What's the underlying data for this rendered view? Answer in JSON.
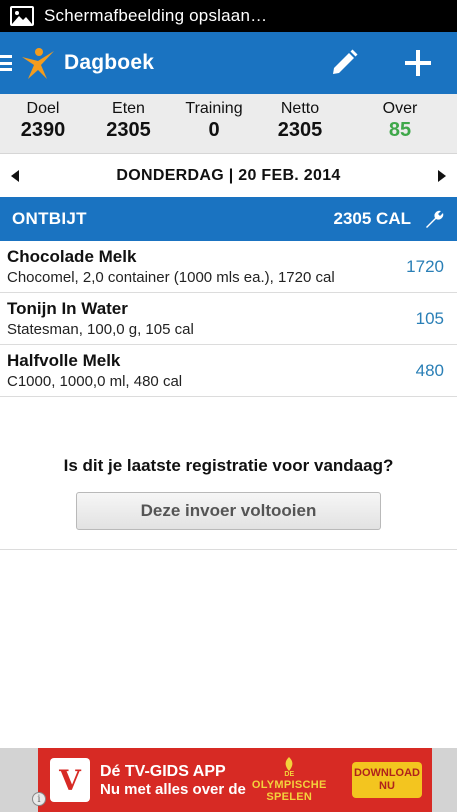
{
  "statusbar": {
    "text": "Schermafbeelding opslaan…",
    "icon": "image-icon"
  },
  "actionbar": {
    "title": "Dagboek",
    "color": "#1a73c1",
    "edit_icon": "pencil-icon",
    "add_icon": "plus-icon"
  },
  "summary": {
    "columns": [
      {
        "label": "Doel",
        "value": "2390"
      },
      {
        "label": "Eten",
        "value": "2305"
      },
      {
        "label": "Training",
        "value": "0"
      },
      {
        "label": "Netto",
        "value": "2305"
      },
      {
        "label": "Over",
        "value": "85"
      }
    ],
    "over_color": "#3fa84a"
  },
  "date": {
    "label": "DONDERDAG | 20 FEB. 2014"
  },
  "meal": {
    "name": "ONTBIJT",
    "calories": "2305 CAL"
  },
  "foods": [
    {
      "name": "Chocolade Melk",
      "description": "Chocomel, 2,0 container (1000 mls ea.), 1720 cal",
      "calories": "1720"
    },
    {
      "name": "Tonijn In Water",
      "description": "Statesman, 100,0 g, 105 cal",
      "calories": "105"
    },
    {
      "name": "Halfvolle Melk",
      "description": "C1000, 1000,0 ml, 480 cal",
      "calories": "480"
    }
  ],
  "complete": {
    "question": "Is dit je laatste registratie voor vandaag?",
    "button": "Deze invoer voltooien"
  },
  "ad": {
    "logo": "V",
    "line1": "Dé TV-GIDS APP",
    "line2": "Nu met alles over de",
    "olympic1": "DE",
    "olympic2": "OLYMPISCHE",
    "olympic3": "SPELEN",
    "download1": "DOWNLOAD",
    "download2": "NU",
    "info": "i"
  }
}
